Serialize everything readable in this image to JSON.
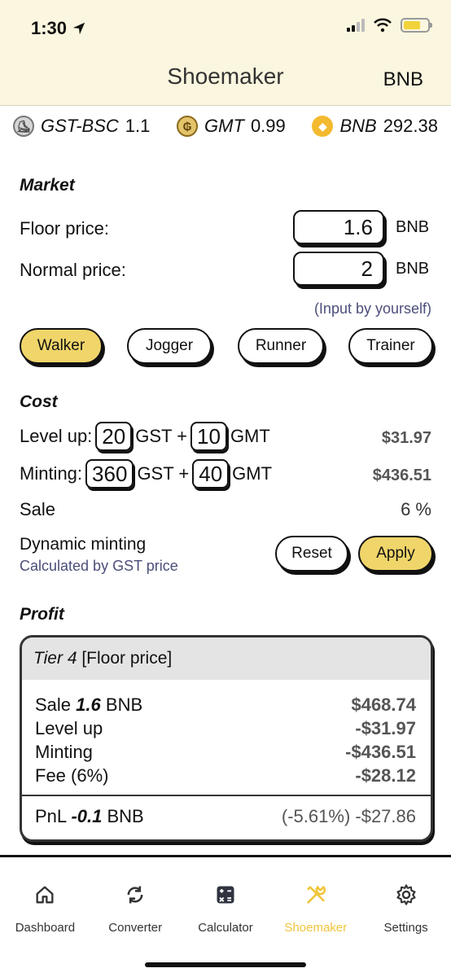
{
  "status": {
    "time": "1:30"
  },
  "header": {
    "title": "Shoemaker",
    "currency": "BNB"
  },
  "ticker": [
    {
      "symbol": "GST-BSC",
      "price": "1.1",
      "icon": "gst-coin-icon"
    },
    {
      "symbol": "GMT",
      "price": "0.99",
      "icon": "gmt-coin-icon"
    },
    {
      "symbol": "BNB",
      "price": "292.38",
      "icon": "bnb-coin-icon"
    }
  ],
  "market": {
    "title": "Market",
    "floor_label": "Floor price:",
    "floor_value": "1.6",
    "normal_label": "Normal price:",
    "normal_value": "2",
    "unit": "BNB",
    "hint": "(Input by yourself)"
  },
  "types": [
    "Walker",
    "Jogger",
    "Runner",
    "Trainer"
  ],
  "cost": {
    "title": "Cost",
    "levelup_label": "Level up:",
    "levelup_gst": "20",
    "levelup_gmt": "10",
    "levelup_amount": "$31.97",
    "minting_label": "Minting:",
    "minting_gst": "360",
    "minting_gmt": "40",
    "minting_amount": "$436.51",
    "gst_plus": "GST +",
    "gmt_unit": "GMT",
    "sale_label": "Sale",
    "sale_value": "6 %",
    "dyn_label": "Dynamic minting",
    "dyn_sub": "Calculated by GST price",
    "reset": "Reset",
    "apply": "Apply"
  },
  "profit": {
    "title": "Profit",
    "tier": "Tier 4",
    "tier_note": "[Floor price]",
    "sale_label": "Sale",
    "sale_amount": "1.6",
    "sale_unit": "BNB",
    "sale_value": "$468.74",
    "levelup_label": "Level up",
    "levelup_value": "-$31.97",
    "minting_label": "Minting",
    "minting_value": "-$436.51",
    "fee_label": "Fee (6%)",
    "fee_value": "-$28.12",
    "pnl_label": "PnL",
    "pnl_amount": "-0.1",
    "pnl_unit": "BNB",
    "pnl_value": "(-5.61%) -$27.86"
  },
  "tabs": [
    {
      "label": "Dashboard",
      "icon": "home-icon"
    },
    {
      "label": "Converter",
      "icon": "sync-icon"
    },
    {
      "label": "Calculator",
      "icon": "calculator-icon"
    },
    {
      "label": "Shoemaker",
      "icon": "tools-icon"
    },
    {
      "label": "Settings",
      "icon": "gear-icon"
    }
  ],
  "colors": {
    "accent": "#f0d56a",
    "header_bg": "#fbf6df",
    "tab_active": "#f0c53a"
  }
}
